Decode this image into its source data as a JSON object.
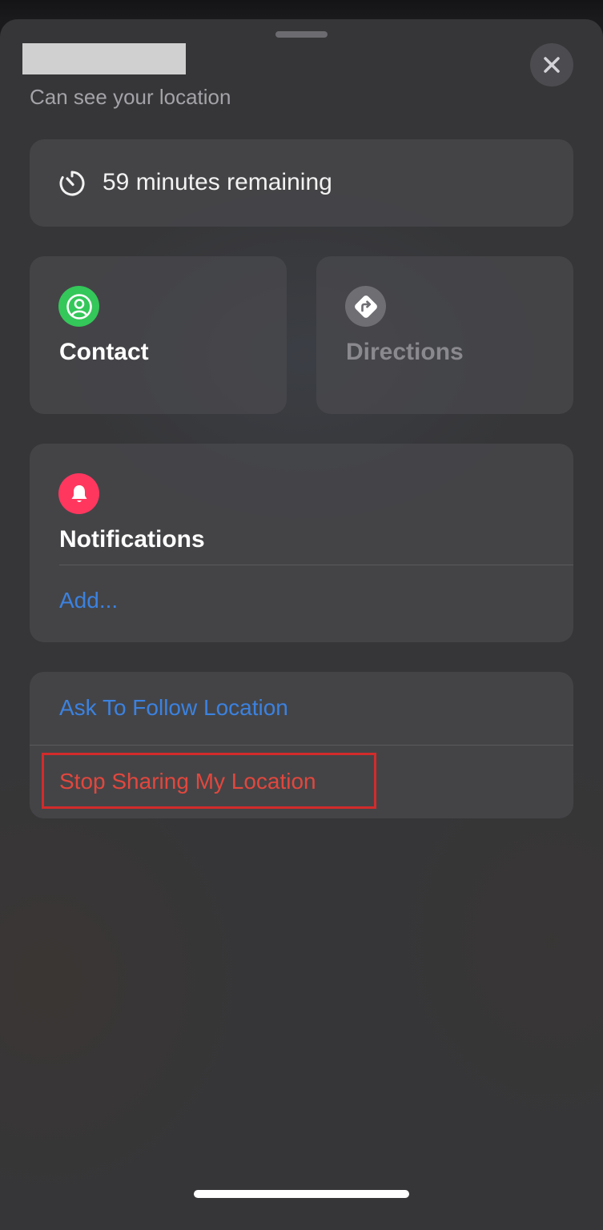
{
  "header": {
    "subtitle": "Can see your location"
  },
  "icons": {
    "close": "close-icon",
    "timer": "timer-icon",
    "contact": "person-icon",
    "directions": "directions-icon",
    "notifications": "bell-icon"
  },
  "timer": {
    "label": "59 minutes remaining"
  },
  "tiles": {
    "contact": {
      "label": "Contact",
      "icon_color": "#34c759",
      "enabled": true
    },
    "directions": {
      "label": "Directions",
      "icon_color": "#6e6e73",
      "enabled": false
    }
  },
  "notifications": {
    "title": "Notifications",
    "icon_color": "#ff375f",
    "add_label": "Add..."
  },
  "actions": {
    "ask_follow": "Ask To Follow Location",
    "stop_sharing": "Stop Sharing My Location"
  },
  "colors": {
    "link_blue": "#3b82e0",
    "destructive_red": "#e2473d",
    "highlight_red": "#d32b2b"
  }
}
